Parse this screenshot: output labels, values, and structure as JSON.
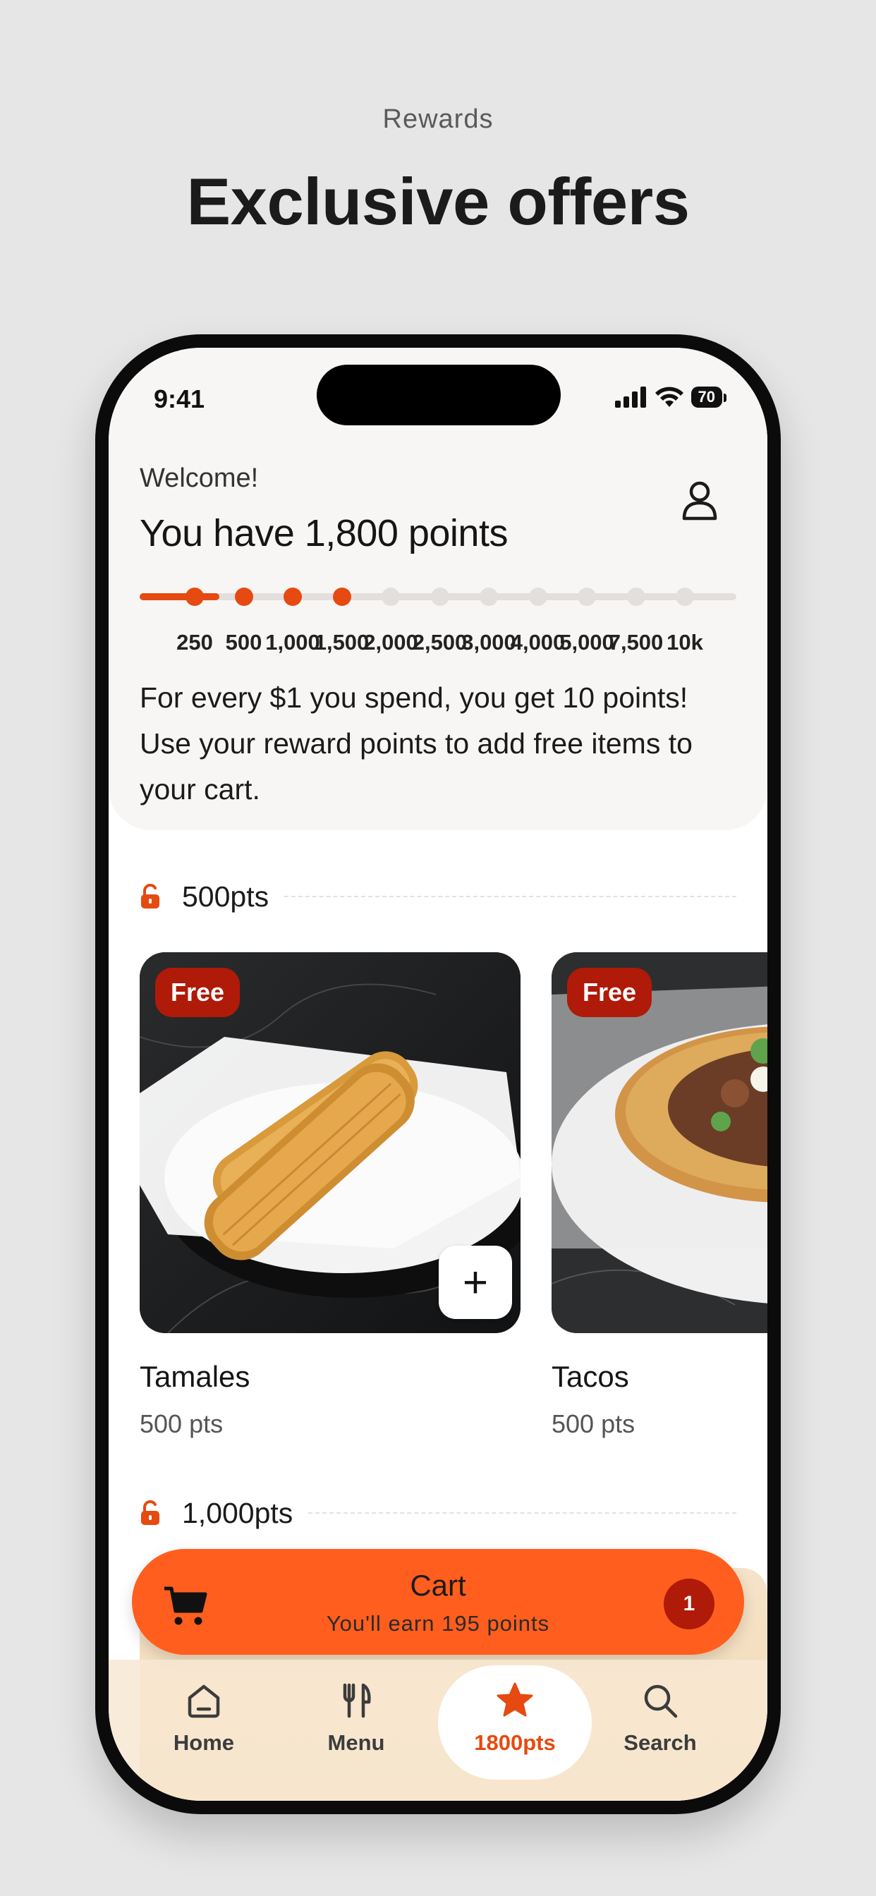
{
  "page": {
    "caption": "Rewards",
    "headline": "Exclusive offers"
  },
  "status_bar": {
    "time": "9:41",
    "battery": "70"
  },
  "header": {
    "welcome": "Welcome!",
    "points_title": "You have 1,800 points",
    "profile_icon": "person-icon"
  },
  "progress": {
    "current_points": 1800,
    "ticks": [
      "250",
      "500",
      "1,000",
      "1,500",
      "2,000",
      "2,500",
      "3,000",
      "4,000",
      "5,000",
      "7,500",
      "10k"
    ],
    "reached_count": 4
  },
  "info_text": "For every $1 you spend, you get 10 points! Use your reward points to add free items to your cart.",
  "tiers": [
    {
      "label": "500pts",
      "items": [
        {
          "badge": "Free",
          "name": "Tamales",
          "points": "500 pts"
        },
        {
          "badge": "Free",
          "name": "Tacos",
          "points": "500 pts"
        }
      ]
    },
    {
      "label": "1,000pts"
    }
  ],
  "cart": {
    "title": "Cart",
    "subtitle": "You'll earn 195 points",
    "count": "1"
  },
  "tabs": [
    {
      "label": "Home",
      "icon": "home-icon"
    },
    {
      "label": "Menu",
      "icon": "fork-knife-icon"
    },
    {
      "label": "1800pts",
      "icon": "star-icon",
      "active": true
    },
    {
      "label": "Search",
      "icon": "search-icon"
    }
  ],
  "colors": {
    "accent": "#e64a10",
    "cart": "#ff5e1e",
    "badge": "#b01a08",
    "page_background": "#e6e6e7"
  }
}
